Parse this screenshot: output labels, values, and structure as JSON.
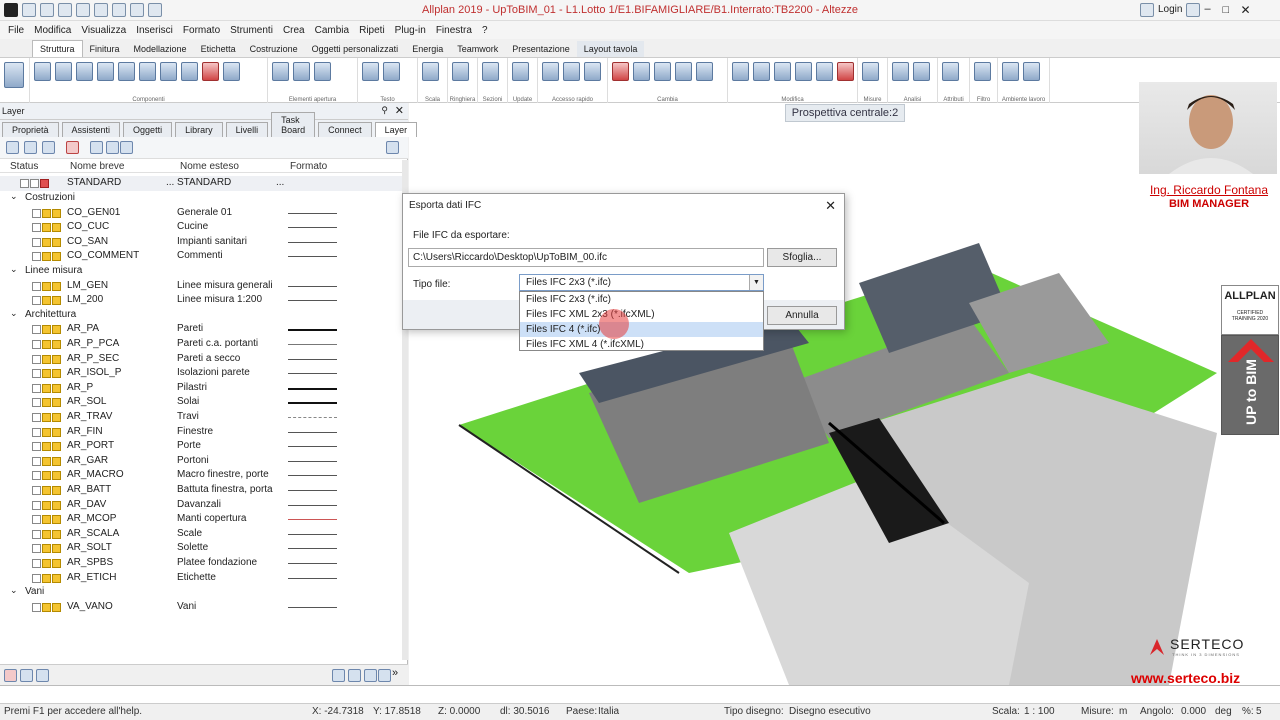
{
  "app": {
    "title": "Allplan 2019 - UpToBIM_01 - L1.Lotto 1/E1.BIFAMIGLIARE/B1.Interrato:TB2200 - Altezze",
    "login": "Login"
  },
  "menu": [
    "File",
    "Modifica",
    "Visualizza",
    "Inserisci",
    "Formato",
    "Strumenti",
    "Crea",
    "Cambia",
    "Ripeti",
    "Plug-in",
    "Finestra",
    "?"
  ],
  "ribbon_tabs": [
    "Struttura",
    "Finitura",
    "Modellazione",
    "Etichetta",
    "Costruzione",
    "Oggetti personalizzati",
    "Energia",
    "Teamwork",
    "Presentazione",
    "Layout tavola"
  ],
  "ribbon_groups": [
    "Componenti",
    "Elementi apertura",
    "Testo",
    "Scala",
    "Ringhiera",
    "Sezioni",
    "Update",
    "Accesso rapido",
    "Cambia",
    "Modifica",
    "Misure",
    "Analisi",
    "Attributi",
    "Filtro",
    "Ambiente lavoro"
  ],
  "panel": {
    "title": "Layer",
    "tabs": [
      "Proprietà",
      "Assistenti",
      "Oggetti",
      "Library",
      "Livelli",
      "Task Board",
      "Connect",
      "Layer"
    ],
    "columns": [
      "Status",
      "Nome breve",
      "Nome esteso",
      "Formato"
    ],
    "standard": {
      "short": "STANDARD",
      "dots1": "...",
      "long": "STANDARD",
      "dots2": "..."
    },
    "groups": [
      {
        "name": "Costruzioni",
        "rows": [
          {
            "short": "CO_GEN01",
            "long": "Generale 01"
          },
          {
            "short": "CO_CUC",
            "long": "Cucine"
          },
          {
            "short": "CO_SAN",
            "long": "Impianti sanitari"
          },
          {
            "short": "CO_COMMENT",
            "long": "Commenti"
          }
        ]
      },
      {
        "name": "Linee misura",
        "rows": [
          {
            "short": "LM_GEN",
            "long": "Linee misura generali"
          },
          {
            "short": "LM_200",
            "long": "Linee misura 1:200"
          }
        ]
      },
      {
        "name": "Architettura",
        "rows": [
          {
            "short": "AR_PA",
            "long": "Pareti"
          },
          {
            "short": "AR_P_PCA",
            "long": "Pareti c.a. portanti"
          },
          {
            "short": "AR_P_SEC",
            "long": "Pareti a secco"
          },
          {
            "short": "AR_ISOL_P",
            "long": "Isolazioni parete"
          },
          {
            "short": "AR_P",
            "long": "Pilastri"
          },
          {
            "short": "AR_SOL",
            "long": "Solai"
          },
          {
            "short": "AR_TRAV",
            "long": "Travi"
          },
          {
            "short": "AR_FIN",
            "long": "Finestre"
          },
          {
            "short": "AR_PORT",
            "long": "Porte"
          },
          {
            "short": "AR_GAR",
            "long": "Portoni"
          },
          {
            "short": "AR_MACRO",
            "long": "Macro finestre, porte"
          },
          {
            "short": "AR_BATT",
            "long": "Battuta finestra, porta"
          },
          {
            "short": "AR_DAV",
            "long": "Davanzali"
          },
          {
            "short": "AR_MCOP",
            "long": "Manti copertura"
          },
          {
            "short": "AR_SCALA",
            "long": "Scale"
          },
          {
            "short": "AR_SOLT",
            "long": "Solette"
          },
          {
            "short": "AR_SPBS",
            "long": "Platee fondazione"
          },
          {
            "short": "AR_ETICH",
            "long": "Etichette"
          }
        ]
      },
      {
        "name": "Vani",
        "rows": [
          {
            "short": "VA_VANO",
            "long": "Vani"
          }
        ]
      }
    ]
  },
  "viewport": {
    "label": "Prospettiva centrale:2"
  },
  "dialog": {
    "title": "Esporta dati IFC",
    "file_label": "File IFC da esportare:",
    "file_value": "C:\\Users\\Riccardo\\Desktop\\UpToBIM_00.ifc",
    "browse": "Sfoglia...",
    "type_label": "Tipo file:",
    "type_value": "Files IFC 2x3 (*.ifc)",
    "options": [
      "Files IFC 2x3 (*.ifc)",
      "Files IFC XML 2x3 (*.ifcXML)",
      "Files IFC 4 (*.ifc)",
      "Files IFC XML 4 (*.ifcXML)"
    ],
    "selected_option": 2,
    "cancel": "Annulla"
  },
  "overlay": {
    "name": "Ing. Riccardo Fontana",
    "role": "BIM MANAGER",
    "badge_brand": "ALLPLAN",
    "badge_sub1": "CERTIFIED",
    "badge_sub2": "TRAINING 2020",
    "badge_up": "UP to BIM",
    "company": "SERTECO",
    "company_sub": "THINK IN 3 DIMENSIONS",
    "url": "www.serteco.biz"
  },
  "status": {
    "help": "Premi F1 per accedere all'help.",
    "x": "X:  -24.7318",
    "y": "Y:  17.8518",
    "z": "Z:  0.0000",
    "dl": "dl:  30.5016",
    "paese_label": "Paese:",
    "paese": "Italia",
    "tipo_label": "Tipo disegno:",
    "tipo": "Disegno esecutivo",
    "scala_label": "Scala:",
    "scala": "1 : 100",
    "misure_label": "Misure:",
    "misure": "m",
    "angolo_label": "Angolo:",
    "angolo": "0.000",
    "deg": "deg",
    "pct": "%:",
    "pct_val": "5"
  }
}
